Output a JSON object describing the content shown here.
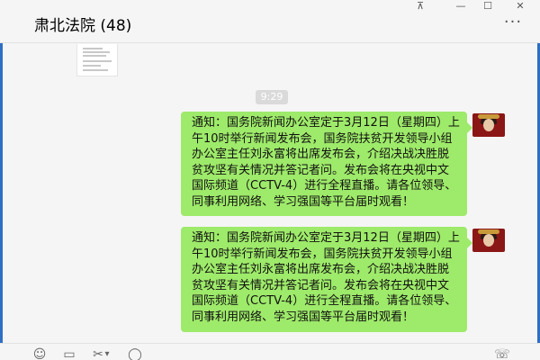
{
  "window": {
    "title": "肃北法院 (48)",
    "controls": {
      "pin": "⊼",
      "minimize": "—",
      "maximize": "☐",
      "close": "✕"
    },
    "more": "···"
  },
  "chat": {
    "time_divider": "9:29",
    "messages": [
      {
        "sender": "me",
        "text": "通知：国务院新闻办公室定于3月12日（星期四）上午10时举行新闻发布会，国务院扶贫开发领导小组办公室主任刘永富将出席发布会，介绍决战决胜脱贫攻坚有关情况并答记者问。发布会将在央视中文国际频道（CCTV-4）进行全程直播。请各位领导、同事利用网络、学习强国等平台届时观看！"
      },
      {
        "sender": "me",
        "text": "通知：国务院新闻办公室定于3月12日（星期四）上午10时举行新闻发布会，国务院扶贫开发领导小组办公室主任刘永富将出席发布会，介绍决战决胜脱贫攻坚有关情况并答记者问。发布会将在央视中文国际频道（CCTV-4）进行全程直播。请各位领导、同事利用网络、学习强国等平台届时观看！"
      }
    ]
  },
  "toolbar": {
    "emoji_icon": "☺",
    "file_icon": "▭",
    "scissors_icon": "✂",
    "dropdown_icon": "▾",
    "chat_icon": "◯",
    "call_icon": "☏"
  },
  "colors": {
    "bubble": "#9eea6a",
    "background": "#f5f5f5",
    "edge": "#2e6fc4",
    "time_chip": "#dadada"
  }
}
